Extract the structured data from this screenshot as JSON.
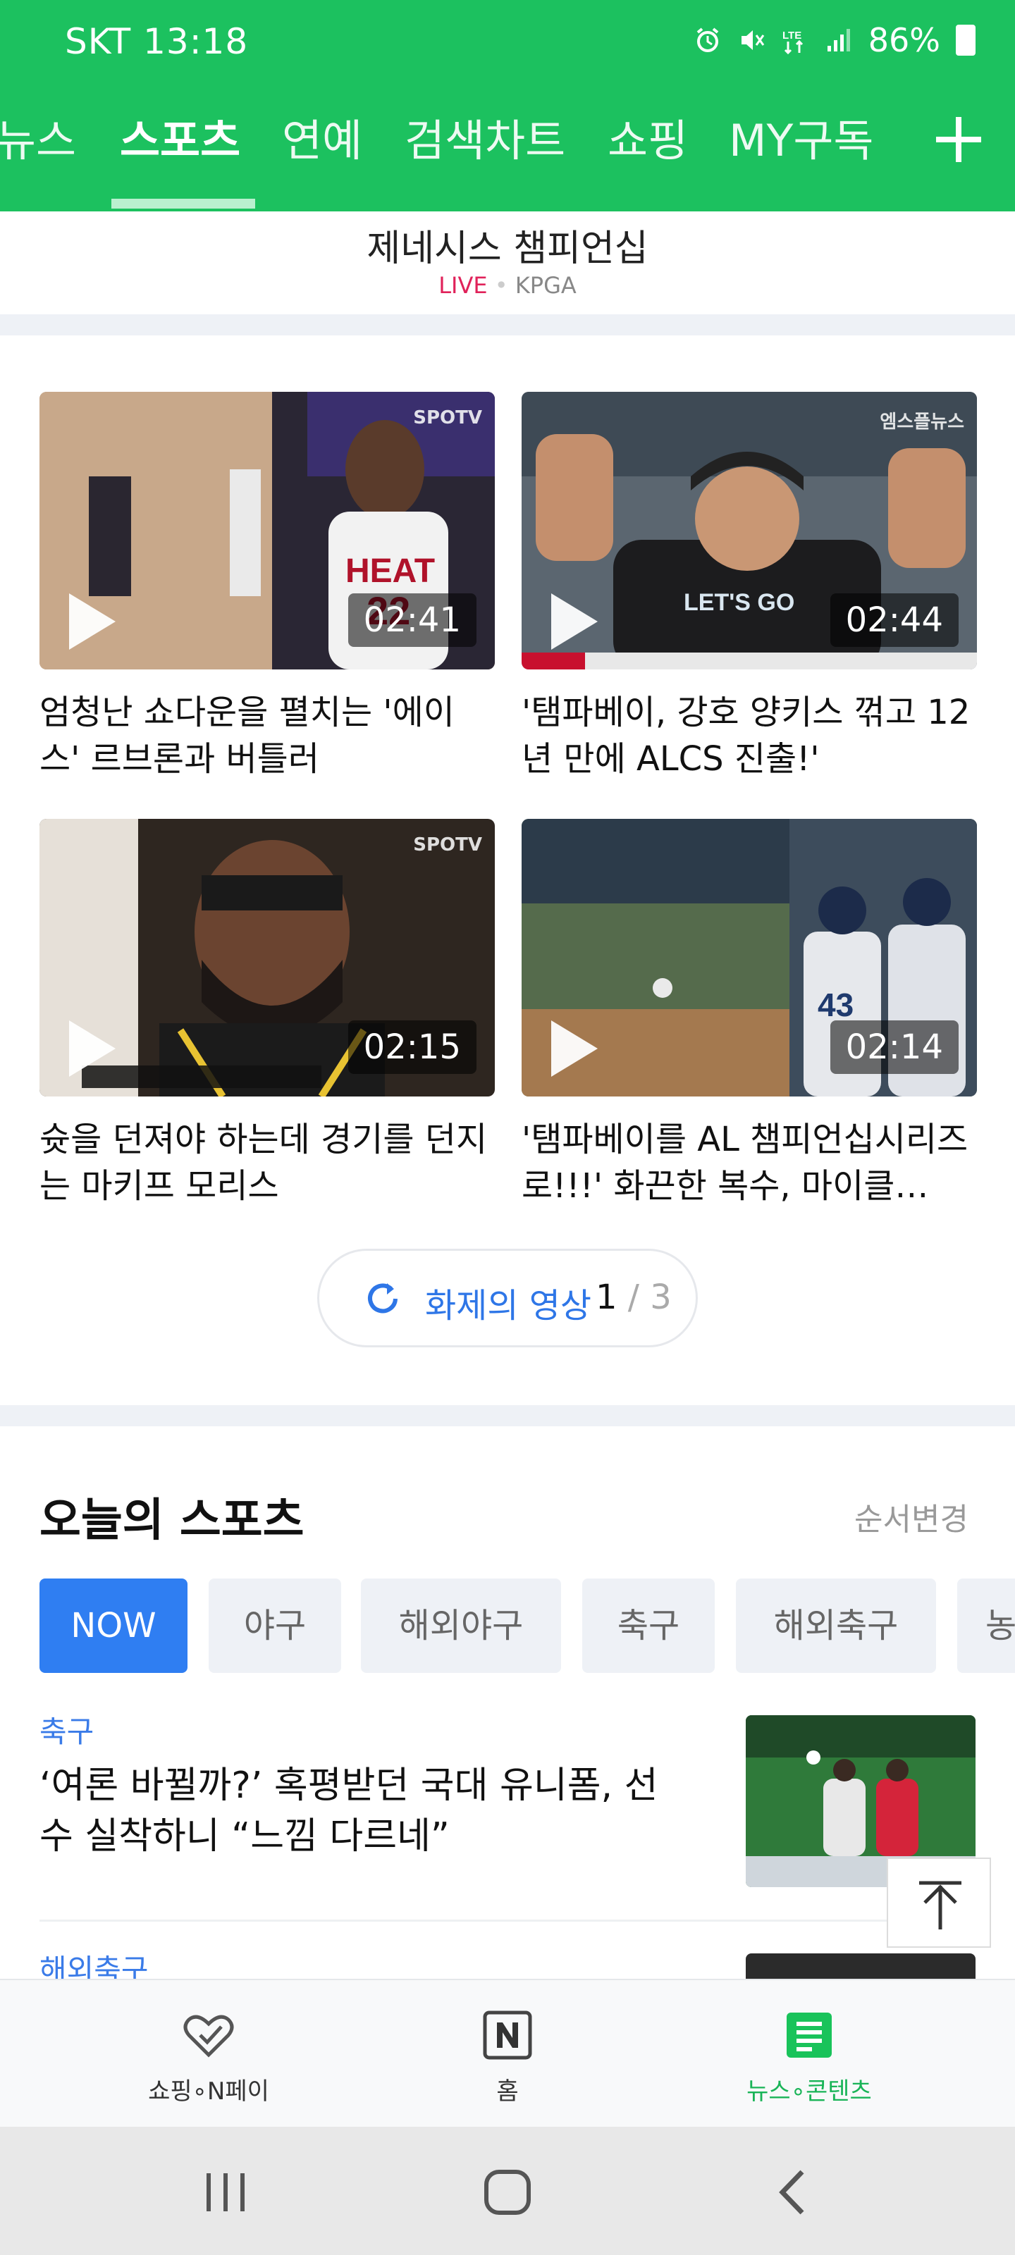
{
  "status_bar": {
    "carrier_time": "SKT 13:18",
    "battery": "86%"
  },
  "tabs": [
    {
      "label": "뉴스"
    },
    {
      "label": "스포츠"
    },
    {
      "label": "연예"
    },
    {
      "label": "검색차트"
    },
    {
      "label": "쇼핑"
    },
    {
      "label": "MY구독"
    }
  ],
  "live_card": {
    "title": "제네시스 챔피언십",
    "live": "LIVE",
    "dot": "•",
    "league": "KPGA"
  },
  "videos": [
    {
      "title": "엄청난 쇼다운을 펼치는 '에이스' 르브론과 버틀러",
      "duration": "02:41",
      "logo": "SPOTV"
    },
    {
      "title": "'탬파베이, 강호 양키스 꺾고 12년 만에 ALCS 진출!'",
      "duration": "02:44",
      "logo": "엠스플뉴스"
    },
    {
      "title": "슛을 던져야 하는데 경기를 던지는 마키프 모리스",
      "duration": "02:15",
      "logo": "SPOTV"
    },
    {
      "title": "'탬파베이를 AL 챔피언십시리즈로!!!' 화끈한 복수, 마이클…",
      "duration": "02:14",
      "logo": ""
    }
  ],
  "more_button": {
    "label": "화제의 영상",
    "page": "1",
    "total": "3"
  },
  "today_sports": {
    "title": "오늘의 스포츠",
    "reorder": "순서변경",
    "chips": [
      "NOW",
      "야구",
      "해외야구",
      "축구",
      "해외축구",
      "농"
    ]
  },
  "articles": [
    {
      "category": "축구",
      "title": "‘여론 바뀔까?’ 혹평받던 국대 유니폼, 선수 실착하니 “느낌 다르네”"
    },
    {
      "category": "해외축구"
    }
  ],
  "bottom_nav": [
    {
      "label": "쇼핑∘N페이"
    },
    {
      "label": "홈"
    },
    {
      "label": "뉴스∘콘텐츠"
    }
  ],
  "colors": {
    "brand_green": "#1cc15f",
    "accent_blue": "#2f7ef2",
    "live_red": "#e0225a"
  }
}
